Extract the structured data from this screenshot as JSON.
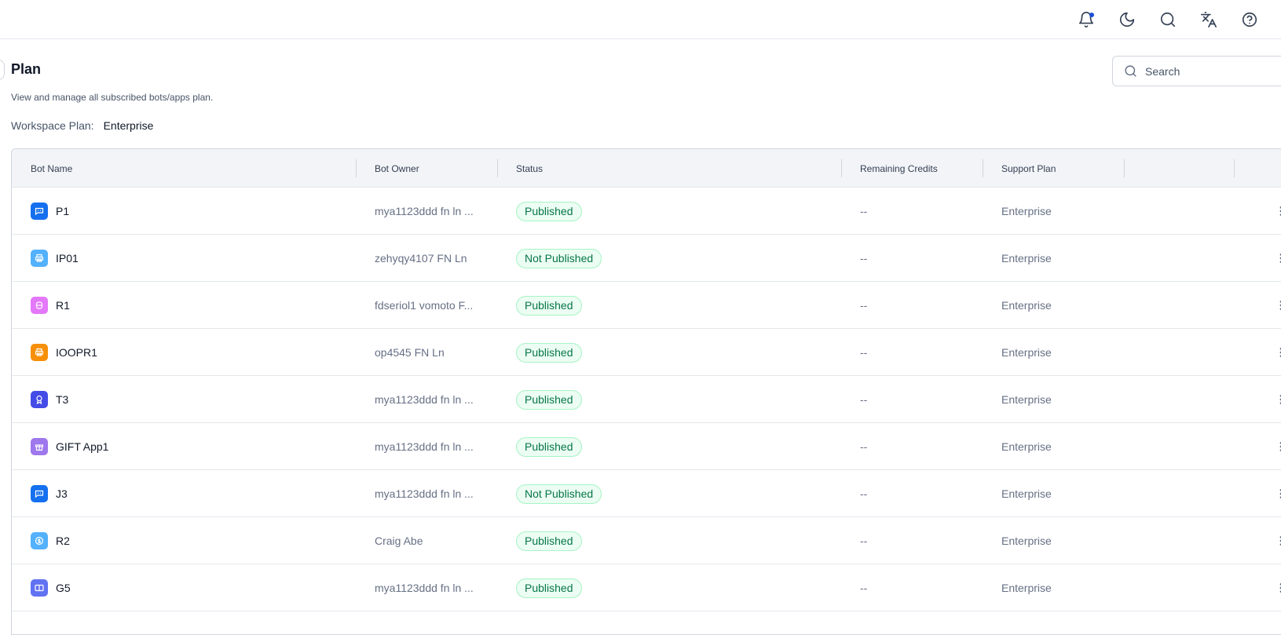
{
  "page": {
    "title": "Plan",
    "subtitle": "View and manage all subscribed bots/apps plan.",
    "workspace_plan_label": "Workspace Plan:",
    "workspace_plan_value": "Enterprise"
  },
  "search": {
    "placeholder": "Search"
  },
  "topbar": {
    "icons": [
      "bell-icon",
      "moon-icon",
      "search-icon",
      "translate-icon",
      "help-icon"
    ],
    "notification_dot_color": "#1d4ed8"
  },
  "table": {
    "columns": [
      "Bot Name",
      "Bot Owner",
      "Status",
      "Remaining Credits",
      "Support Plan"
    ],
    "rows": [
      {
        "name": "P1",
        "owner": "mya1123ddd fn ln ...",
        "status": "Published",
        "credits": "--",
        "support": "Enterprise",
        "icon": "chat-icon",
        "icon_color": "#1570ef"
      },
      {
        "name": "IP01",
        "owner": "zehyqy4107 FN Ln",
        "status": "Not Published",
        "credits": "--",
        "support": "Enterprise",
        "icon": "printer-icon",
        "icon_color": "#53b1fd"
      },
      {
        "name": "R1",
        "owner": "fdseriol1 vomoto F...",
        "status": "Published",
        "credits": "--",
        "support": "Enterprise",
        "icon": "bot-icon",
        "icon_color": "#e478fa"
      },
      {
        "name": "IOOPR1",
        "owner": "op4545 FN Ln",
        "status": "Published",
        "credits": "--",
        "support": "Enterprise",
        "icon": "printer-icon",
        "icon_color": "#f79009"
      },
      {
        "name": "T3",
        "owner": "mya1123ddd fn ln ...",
        "status": "Published",
        "credits": "--",
        "support": "Enterprise",
        "icon": "award-icon",
        "icon_color": "#444ce7"
      },
      {
        "name": "GIFT App1",
        "owner": "mya1123ddd fn ln ...",
        "status": "Published",
        "credits": "--",
        "support": "Enterprise",
        "icon": "gift-icon",
        "icon_color": "#9e77ed"
      },
      {
        "name": "J3",
        "owner": "mya1123ddd fn ln ...",
        "status": "Not Published",
        "credits": "--",
        "support": "Enterprise",
        "icon": "chat-icon",
        "icon_color": "#1570ef"
      },
      {
        "name": "R2",
        "owner": "Craig Abe",
        "status": "Published",
        "credits": "--",
        "support": "Enterprise",
        "icon": "coin-icon",
        "icon_color": "#53b1fd"
      },
      {
        "name": "G5",
        "owner": "mya1123ddd fn ln ...",
        "status": "Published",
        "credits": "--",
        "support": "Enterprise",
        "icon": "cards-icon",
        "icon_color": "#6172f3"
      }
    ]
  }
}
